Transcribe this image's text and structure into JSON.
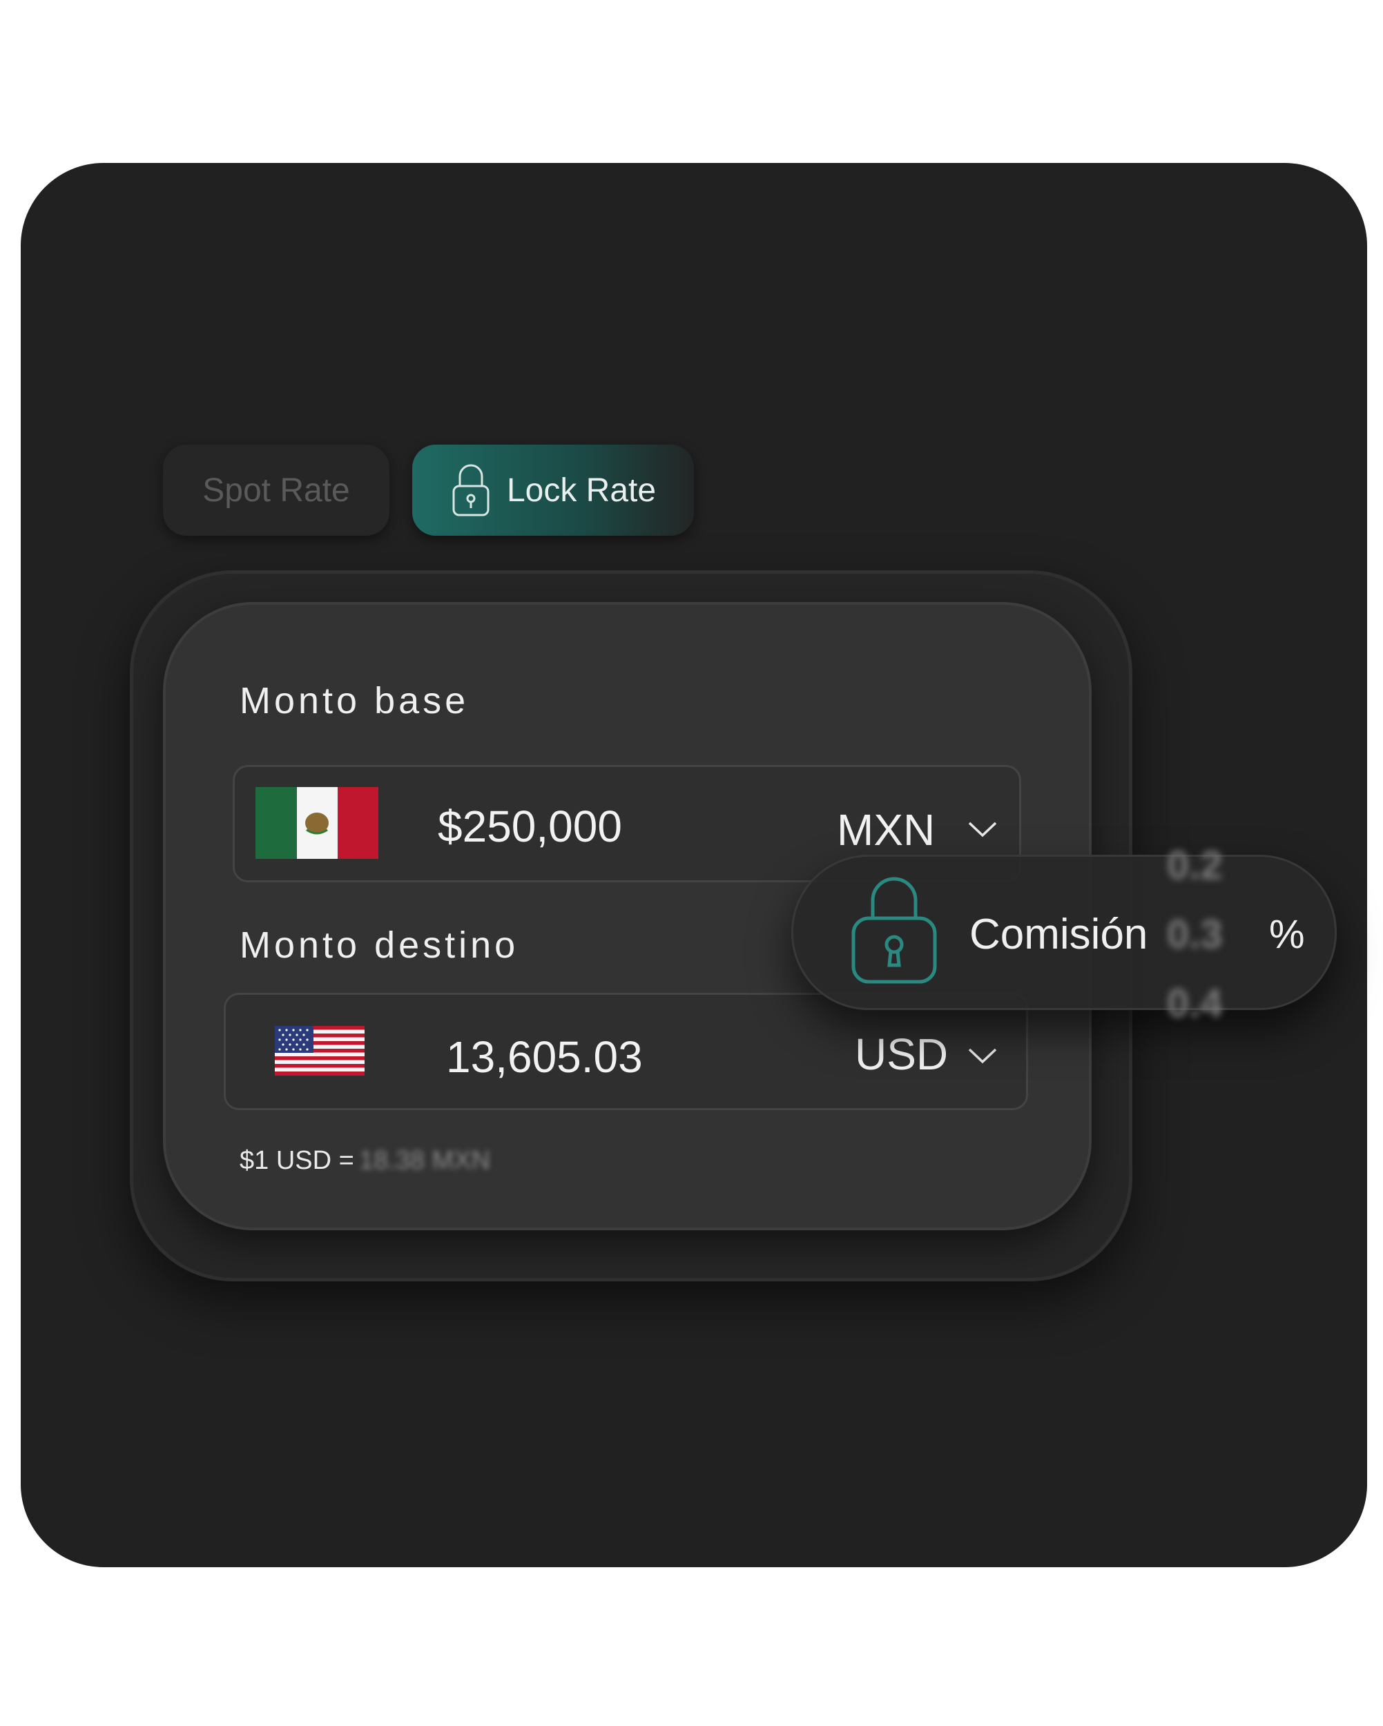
{
  "tabs": {
    "spot_label": "Spot Rate",
    "lock_label": "Lock Rate"
  },
  "base": {
    "label": "Monto base",
    "amount": "$250,000",
    "currency": "MXN"
  },
  "destination": {
    "label": "Monto destino",
    "amount": "13,605.03",
    "currency": "USD"
  },
  "exchange_rate": {
    "prefix": "$1 USD =",
    "value": "18.38 MXN"
  },
  "commission": {
    "label": "Comisión",
    "unit": "%",
    "options": [
      "0.2",
      "0.3",
      "0.4"
    ]
  },
  "colors": {
    "frame": "#212121",
    "accent": "#1f6a63",
    "lock_icon": "#2c8f86"
  },
  "icons": {
    "tab_lock": "lock-icon",
    "commission_lock": "lock-icon",
    "dropdown": "chevron-down-icon",
    "base_flag": "mexico-flag-icon",
    "destination_flag": "usa-flag-icon"
  }
}
